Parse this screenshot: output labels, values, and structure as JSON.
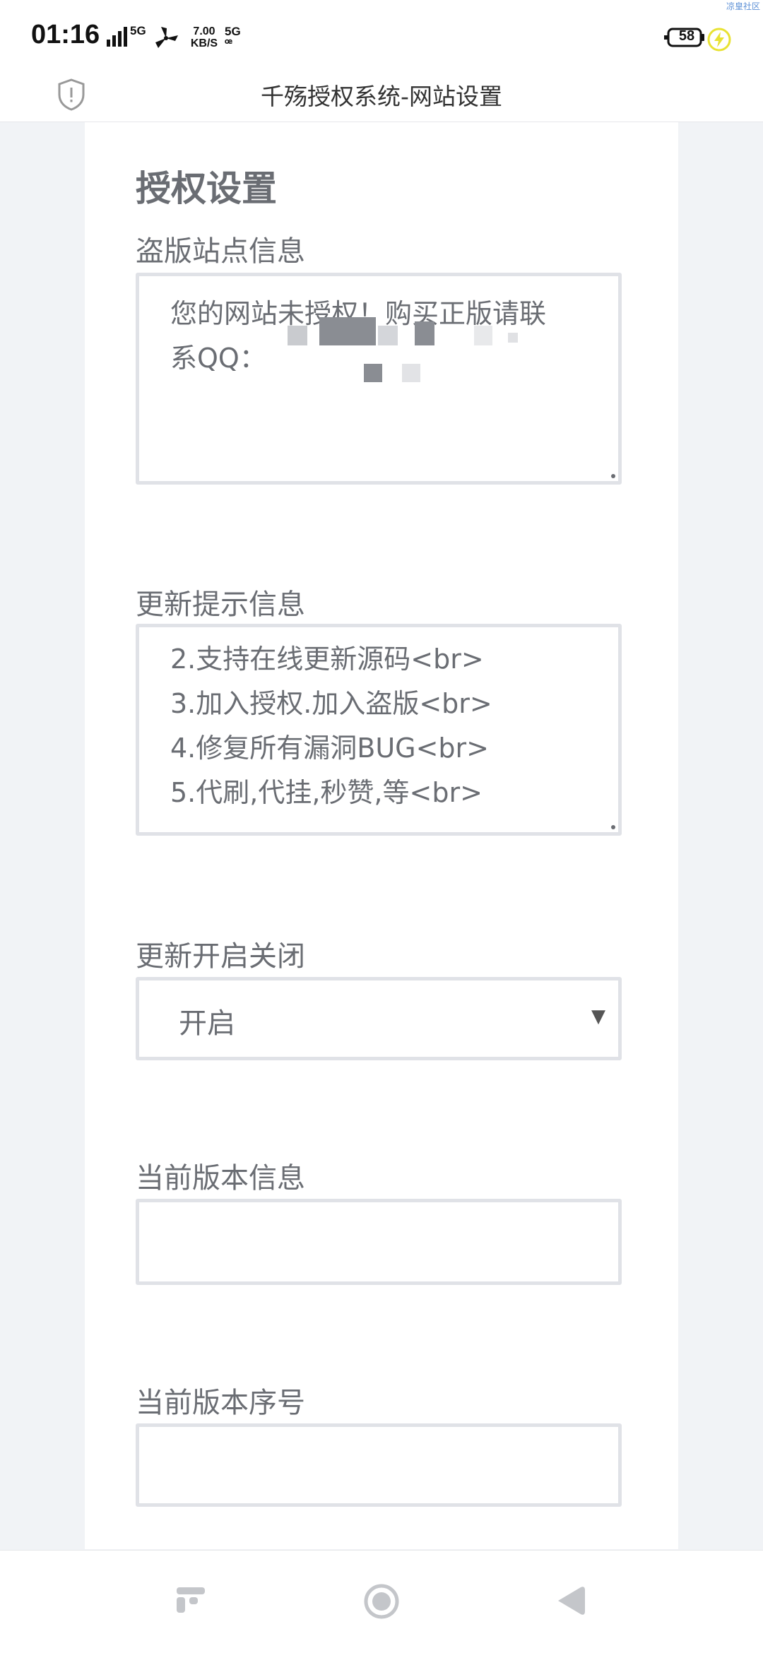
{
  "status_bar": {
    "time": "01:16",
    "network_a": "5G",
    "speed_value": "7.00",
    "speed_unit": "KB/S",
    "network_b": "5G",
    "battery": "58",
    "watermark": "凉皇社区"
  },
  "title_bar": {
    "title": "千殇授权系统-网站设置",
    "icon": "shield-alert-icon"
  },
  "form": {
    "heading": "授权设置",
    "fields": [
      {
        "label": "盗版站点信息",
        "value": "您的网站未授权！购买正版请联\n系QQ：",
        "type": "textarea"
      },
      {
        "label": "更新提示信息",
        "value": "2.支持在线更新源码<br>\n3.加入授权.加入盗版<br>\n4.修复所有漏洞BUG<br>\n5.代刷,代挂,秒赞,等<br>",
        "type": "textarea"
      },
      {
        "label": "更新开启关闭",
        "value": "开启",
        "type": "select"
      },
      {
        "label": "当前版本信息",
        "value": "",
        "type": "input"
      },
      {
        "label": "当前版本序号",
        "value": "",
        "type": "input"
      }
    ]
  },
  "nav_bar": {
    "items": [
      "recent-apps-icon",
      "home-icon",
      "back-icon"
    ]
  },
  "colors": {
    "page_bg": "#f1f3f6",
    "card_bg": "#ffffff",
    "text": "#6a6d73",
    "border": "#e0e2e7",
    "charge": "#e8e233"
  }
}
